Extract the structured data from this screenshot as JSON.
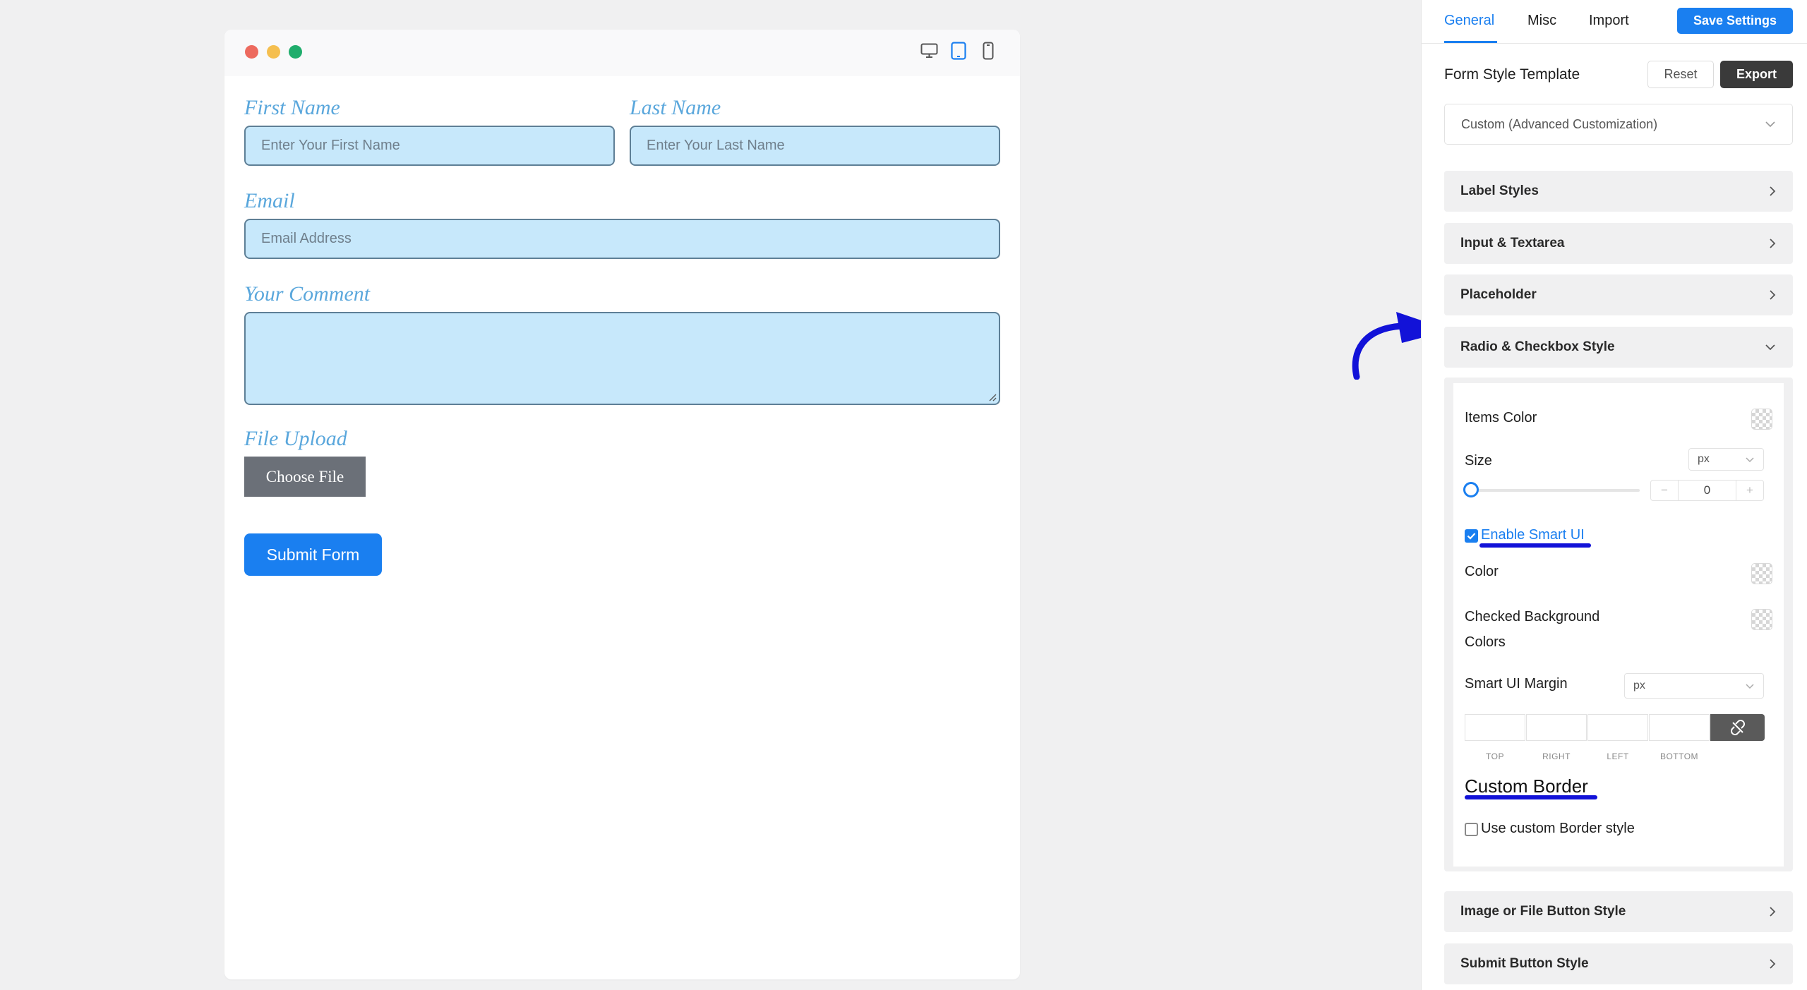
{
  "preview": {
    "window_dots": [
      "close",
      "minimize",
      "maximize"
    ],
    "dot_colors": [
      "#ed6a5e",
      "#f5bf4f",
      "#61c554"
    ],
    "devices": [
      {
        "name": "desktop-icon",
        "active": false
      },
      {
        "name": "tablet-icon",
        "active": true
      },
      {
        "name": "mobile-icon",
        "active": false
      }
    ],
    "form": {
      "first_name_label": "First Name",
      "first_name_placeholder": "Enter Your First Name",
      "last_name_label": "Last Name",
      "last_name_placeholder": "Enter Your Last Name",
      "email_label": "Email",
      "email_placeholder": "Email Address",
      "comment_label": "Your Comment",
      "file_label": "File Upload",
      "choose_file": "Choose File",
      "submit": "Submit Form"
    }
  },
  "panel": {
    "tabs": [
      "General",
      "Misc",
      "Import"
    ],
    "active_tab": "General",
    "save_label": "Save Settings",
    "template_title": "Form Style Template",
    "reset_label": "Reset",
    "export_label": "Export",
    "template_value": "Custom (Advanced Customization)",
    "sections": {
      "label_styles": "Label Styles",
      "input_textarea": "Input & Textarea",
      "placeholder": "Placeholder",
      "radio_checkbox": "Radio & Checkbox Style",
      "image_file_button": "Image or File Button Style",
      "submit_button": "Submit Button Style"
    },
    "radio": {
      "items_color": "Items Color",
      "size": "Size",
      "size_unit": "px",
      "size_value": "0",
      "minus": "−",
      "plus": "+",
      "enable_smart_ui": "Enable Smart UI",
      "enable_smart_ui_checked": true,
      "color": "Color",
      "checked_bg_line1": "Checked Background",
      "checked_bg_line2": "Colors",
      "smart_ui_margin": "Smart UI Margin",
      "margin_unit": "px",
      "margin_labels": [
        "TOP",
        "RIGHT",
        "LEFT",
        "BOTTOM"
      ],
      "custom_border": "Custom Border",
      "use_custom_border": "Use custom Border style",
      "use_custom_border_checked": false
    }
  },
  "colors": {
    "accent": "#1a7ff0",
    "annotation": "#1212d8",
    "label": "#5aa7dc",
    "input_bg": "#c7e8fb"
  }
}
